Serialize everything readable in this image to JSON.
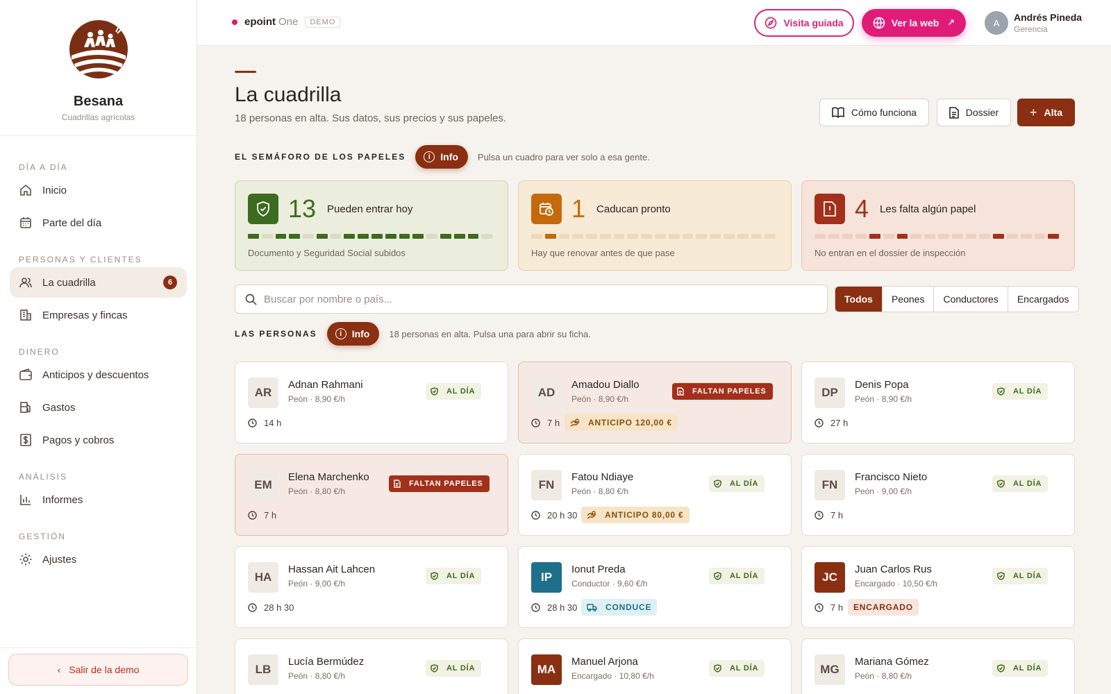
{
  "brand": {
    "name": "Besana",
    "subtitle": "Cuadrillas agrícolas"
  },
  "sidebar": {
    "sections": [
      {
        "title": "DÍA A DÍA",
        "items": [
          {
            "label": "Inicio",
            "icon": "home-icon"
          },
          {
            "label": "Parte del día",
            "icon": "calendar-icon"
          }
        ]
      },
      {
        "title": "PERSONAS Y CLIENTES",
        "items": [
          {
            "label": "La cuadrilla",
            "icon": "users-icon",
            "active": true,
            "badge": "6"
          },
          {
            "label": "Empresas y fincas",
            "icon": "building-icon"
          }
        ]
      },
      {
        "title": "DINERO",
        "items": [
          {
            "label": "Anticipos y descuentos",
            "icon": "wallet-icon"
          },
          {
            "label": "Gastos",
            "icon": "fuel-icon"
          },
          {
            "label": "Pagos y cobros",
            "icon": "dollar-icon"
          }
        ]
      },
      {
        "title": "ANÁLISIS",
        "items": [
          {
            "label": "Informes",
            "icon": "bar-chart-icon"
          }
        ]
      },
      {
        "title": "GESTIÓN",
        "items": [
          {
            "label": "Ajustes",
            "icon": "gear-icon"
          }
        ]
      }
    ],
    "exit_label": "Salir de la demo"
  },
  "topbar": {
    "product": "epoint",
    "product_suffix": "One",
    "demo": "DEMO",
    "tour_label": "Visita guiada",
    "web_label": "Ver la web",
    "user_initial": "A",
    "user_name": "Andrés Pineda",
    "user_role": "Gerencia"
  },
  "page": {
    "title": "La cuadrilla",
    "subtitle": "18 personas en alta. Sus datos, sus precios y sus papeles.",
    "actions": {
      "how": "Cómo funciona",
      "dossier": "Dossier",
      "alta": "Alta"
    }
  },
  "semaforo": {
    "title": "EL SEMÁFORO DE LOS PAPELES",
    "info": "Info",
    "hint": "Pulsa un cuadro para ver solo a esa gente.",
    "cards": [
      {
        "count": "13",
        "label": "Pueden entrar hoy",
        "foot": "Documento y Seguridad Social subidos",
        "segments": [
          1,
          0,
          1,
          1,
          0,
          1,
          0,
          1,
          1,
          1,
          1,
          1,
          1,
          0,
          1,
          1,
          1,
          0
        ]
      },
      {
        "count": "1",
        "label": "Caducan pronto",
        "foot": "Hay que renovar antes de que pase",
        "segments": [
          0,
          1,
          0,
          0,
          0,
          0,
          0,
          0,
          0,
          0,
          0,
          0,
          0,
          0,
          0,
          0,
          0,
          0
        ]
      },
      {
        "count": "4",
        "label": "Les falta algún papel",
        "foot": "No entran en el dossier de inspección",
        "segments": [
          0,
          0,
          0,
          0,
          1,
          0,
          1,
          0,
          0,
          0,
          0,
          0,
          0,
          1,
          0,
          0,
          0,
          1
        ]
      }
    ],
    "colors": {
      "ok_on": "#3d6b1f",
      "ok_off": "#d9dcc6",
      "soon_on": "#c46a0c",
      "soon_off": "#f0d8b8",
      "miss_on": "#a3301a",
      "miss_off": "#edd0c4"
    }
  },
  "search": {
    "placeholder": "Buscar por nombre o país..."
  },
  "filters": [
    "Todos",
    "Peones",
    "Conductores",
    "Encargados"
  ],
  "personas": {
    "title": "LAS PERSONAS",
    "info": "Info",
    "hint": "18 personas en alta. Pulsa una para abrir su ficha.",
    "list": [
      {
        "initials": "AR",
        "name": "Adnan Rahmani",
        "meta": "Peón · 8,90 €/h",
        "status": "AL DÍA",
        "hours": "14 h"
      },
      {
        "initials": "AD",
        "name": "Amadou Diallo",
        "meta": "Peón · 8,90 €/h",
        "status": "FALTAN PAPELES",
        "hours": "7 h",
        "tag": "ANTICIPO 120,00 €",
        "tag_type": "anticipo"
      },
      {
        "initials": "DP",
        "name": "Denis Popa",
        "meta": "Peón · 8,90 €/h",
        "status": "AL DÍA",
        "hours": "27 h"
      },
      {
        "initials": "EM",
        "name": "Elena Marchenko",
        "meta": "Peón · 8,80 €/h",
        "status": "FALTAN PAPELES",
        "hours": "7 h"
      },
      {
        "initials": "FN",
        "name": "Fatou Ndiaye",
        "meta": "Peón · 8,80 €/h",
        "status": "AL DÍA",
        "hours": "20 h 30",
        "tag": "ANTICIPO 80,00 €",
        "tag_type": "anticipo"
      },
      {
        "initials": "FN",
        "name": "Francisco Nieto",
        "meta": "Peón · 9,00 €/h",
        "status": "AL DÍA",
        "hours": "7 h"
      },
      {
        "initials": "HA",
        "name": "Hassan Ait Lahcen",
        "meta": "Peón · 9,00 €/h",
        "status": "AL DÍA",
        "hours": "28 h 30"
      },
      {
        "initials": "IP",
        "name": "Ionut Preda",
        "meta": "Conductor · 9,60 €/h",
        "status": "AL DÍA",
        "hours": "28 h 30",
        "tag": "CONDUCE",
        "tag_type": "conduce",
        "avatar_color": "teal"
      },
      {
        "initials": "JC",
        "name": "Juan Carlos Rus",
        "meta": "Encargado · 10,50 €/h",
        "status": "AL DÍA",
        "hours": "7 h",
        "tag": "ENCARGADO",
        "tag_type": "encargado",
        "avatar_color": "brown"
      },
      {
        "initials": "LB",
        "name": "Lucía Bermúdez",
        "meta": "Peón · 8,80 €/h",
        "status": "AL DÍA",
        "hours": ""
      },
      {
        "initials": "MA",
        "name": "Manuel Arjona",
        "meta": "Encargado · 10,80 €/h",
        "status": "AL DÍA",
        "hours": "",
        "avatar_color": "brown"
      },
      {
        "initials": "MG",
        "name": "Mariana Gómez",
        "meta": "Peón · 8,80 €/h",
        "status": "AL DÍA",
        "hours": ""
      }
    ]
  }
}
